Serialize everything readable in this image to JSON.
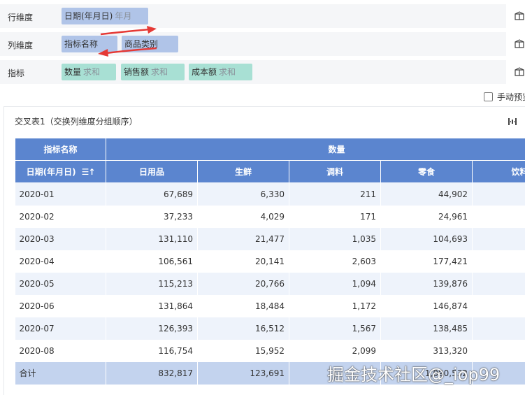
{
  "dimensions": {
    "rows": {
      "label": "行维度",
      "fields": [
        {
          "name": "日期(年月日)",
          "agg": "年月",
          "color": "blue"
        }
      ]
    },
    "cols": {
      "label": "列维度",
      "fields": [
        {
          "name": "指标名称",
          "agg": "",
          "color": "blue"
        },
        {
          "name": "商品类别",
          "agg": "",
          "color": "blue"
        }
      ]
    },
    "metrics": {
      "label": "指标",
      "fields": [
        {
          "name": "数量",
          "agg": "求和",
          "color": "green"
        },
        {
          "name": "销售额",
          "agg": "求和",
          "color": "green"
        },
        {
          "name": "成本额",
          "agg": "求和",
          "color": "green"
        }
      ]
    }
  },
  "manual_preview": {
    "label": "手动预览",
    "checked": false
  },
  "panel": {
    "title": "交叉表1（交换列维度分组顺序）",
    "icon": "column-settings-icon"
  },
  "table": {
    "header_top": {
      "corner": "指标名称",
      "group": "数量"
    },
    "header_second": {
      "corner": "日期(年月日)",
      "sort_icon": "sort-icon",
      "columns": [
        "日用品",
        "生鲜",
        "调料",
        "零食",
        "饮料"
      ]
    },
    "rows": [
      {
        "date": "2020-01",
        "values": [
          "67,689",
          "6,330",
          "211",
          "44,902",
          ""
        ]
      },
      {
        "date": "2020-02",
        "values": [
          "37,233",
          "4,029",
          "171",
          "24,961",
          ""
        ]
      },
      {
        "date": "2020-03",
        "values": [
          "131,110",
          "21,477",
          "1,035",
          "104,693",
          ""
        ]
      },
      {
        "date": "2020-04",
        "values": [
          "106,561",
          "20,141",
          "2,603",
          "177,421",
          ""
        ]
      },
      {
        "date": "2020-05",
        "values": [
          "115,213",
          "20,766",
          "1,094",
          "139,876",
          ""
        ]
      },
      {
        "date": "2020-06",
        "values": [
          "131,864",
          "18,484",
          "1,172",
          "146,874",
          ""
        ]
      },
      {
        "date": "2020-07",
        "values": [
          "126,393",
          "16,512",
          "1,567",
          "138,485",
          ""
        ]
      },
      {
        "date": "2020-08",
        "values": [
          "116,754",
          "15,952",
          "2,099",
          "313,320",
          ""
        ]
      }
    ],
    "total": {
      "label": "合计",
      "values": [
        "832,817",
        "123,691",
        "",
        "1,090,532",
        ""
      ]
    }
  },
  "watermark": "掘金技术社区@_iop99",
  "colors": {
    "header": "#5b85cf",
    "pill_blue": "#b0c4e8",
    "pill_green": "#a8e0d4",
    "row_alt": "#eef3fb",
    "total": "#c3d3ee",
    "arrow": "#e53935"
  }
}
